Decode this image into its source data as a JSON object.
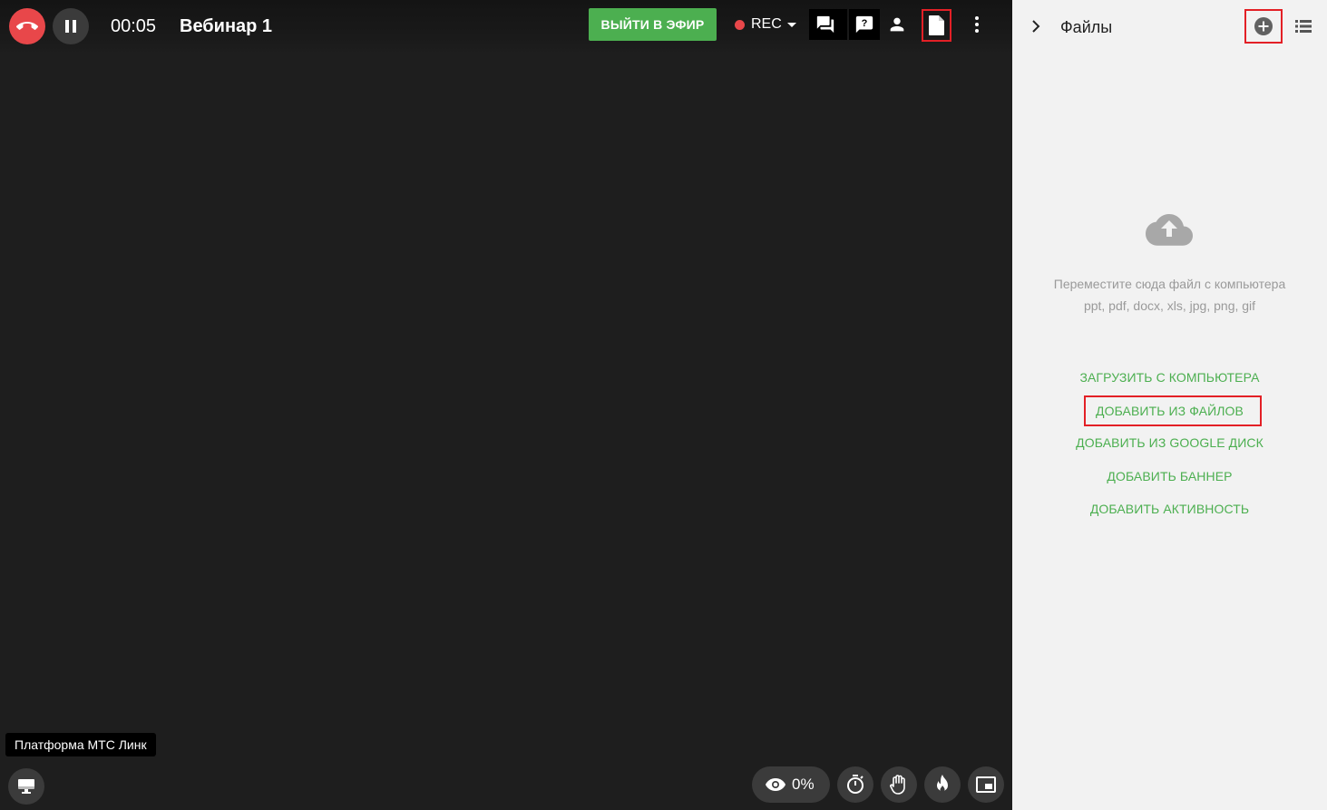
{
  "header": {
    "timer": "00:05",
    "title": "Вебинар 1",
    "go_live_label": "ВЫЙТИ В ЭФИР",
    "rec_label": "REC"
  },
  "footer": {
    "platform_label": "Платформа МТС Линк",
    "viewers_percent": "0%"
  },
  "files_panel": {
    "title": "Файлы",
    "hint_line1": "Переместите сюда файл с компьютера",
    "hint_line2": "ppt, pdf, docx, xls, jpg, png, gif",
    "actions": {
      "upload": "ЗАГРУЗИТЬ С КОМПЬЮТЕРА",
      "from_files": "ДОБАВИТЬ ИЗ ФАЙЛОВ",
      "from_gdrive": "ДОБАВИТЬ ИЗ GOOGLE ДИСК",
      "banner": "ДОБАВИТЬ БАННЕР",
      "activity": "ДОБАВИТЬ АКТИВНОСТЬ"
    }
  },
  "colors": {
    "accent_green": "#4caf50",
    "end_call_red": "#e8474a",
    "highlight_red": "#e32026",
    "stage_bg": "#1e1e1e",
    "panel_bg": "#f2f2f2"
  },
  "icons": {
    "end_call": "phone-hangup-icon",
    "pause": "pause-icon",
    "chat": "chat-icon",
    "questions": "question-icon",
    "participants": "person-icon",
    "files": "file-icon",
    "more": "more-vertical-icon",
    "screen": "monitor-icon",
    "viewers": "eye-icon",
    "timer": "stopwatch-icon",
    "hand": "hand-icon",
    "fire": "fire-icon",
    "pip": "picture-in-picture-icon",
    "collapse": "chevron-right-icon",
    "add": "add-circle-icon",
    "list": "list-view-icon",
    "upload": "cloud-upload-icon"
  }
}
